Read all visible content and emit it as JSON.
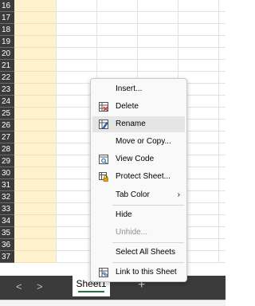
{
  "rows": [
    "16",
    "17",
    "18",
    "19",
    "20",
    "21",
    "22",
    "23",
    "24",
    "25",
    "26",
    "27",
    "28",
    "29",
    "30",
    "31",
    "32",
    "33",
    "34",
    "35",
    "36",
    "37"
  ],
  "context_menu": {
    "items": [
      {
        "label": "Insert...",
        "icon": ""
      },
      {
        "label": "Delete",
        "icon": "delete-sheet-icon"
      },
      {
        "label": "Rename",
        "icon": "rename-sheet-icon",
        "highlighted": true
      },
      {
        "label": "Move or Copy...",
        "icon": ""
      },
      {
        "label": "View Code",
        "icon": "view-code-icon"
      },
      {
        "label": "Protect Sheet...",
        "icon": "protect-sheet-icon"
      },
      {
        "label": "Tab Color",
        "icon": "",
        "submenu": true
      },
      {
        "label": "Hide",
        "icon": ""
      },
      {
        "label": "Unhide...",
        "icon": "",
        "disabled": true
      },
      {
        "label": "Select All Sheets",
        "icon": ""
      },
      {
        "label": "Link to this Sheet",
        "icon": "link-sheet-icon"
      }
    ],
    "submenu_arrow": "›"
  },
  "tabbar": {
    "prev_label": "<",
    "next_label": ">",
    "sheet_name": "Sheet1",
    "add_label": "+"
  },
  "colors": {
    "row_header_bg": "#3b3b3b",
    "selected_column_fill": "#fff2cc",
    "menu_bg": "#f9f9f9",
    "menu_highlight": "#e5e5e5",
    "active_tab_underline": "#217346"
  }
}
